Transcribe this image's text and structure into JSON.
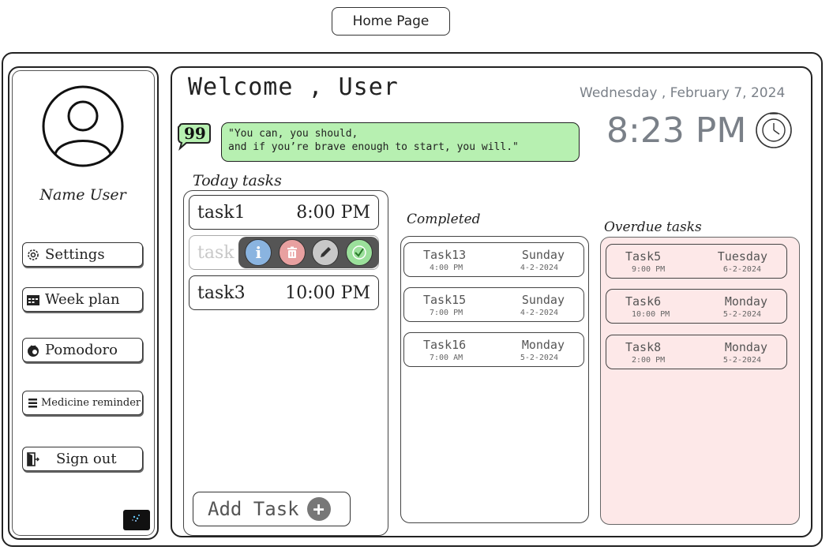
{
  "header": {
    "page_label": "Home Page"
  },
  "sidebar": {
    "user_name": "Name User",
    "items": [
      {
        "label": "Settings",
        "icon": "gear-icon"
      },
      {
        "label": "Week plan",
        "icon": "calendar-icon"
      },
      {
        "label": "Pomodoro",
        "icon": "tomato-timer-icon"
      },
      {
        "label": "Medicine reminder",
        "icon": "medicine-list-icon"
      },
      {
        "label": "Sign out",
        "icon": "exit-door-icon"
      }
    ]
  },
  "main": {
    "welcome": "Welcome , User",
    "date": "Wednesday , February 7, 2024",
    "time": "8:23 PM",
    "quote_line1": "\"You can, you should,",
    "quote_line2": "and if you’re brave enough to start, you will.\"",
    "today_title": "Today tasks",
    "today_tasks": [
      {
        "name": "task1",
        "time": "8:00 PM"
      },
      {
        "name": "task",
        "time": ""
      },
      {
        "name": "task3",
        "time": "10:00 PM"
      }
    ],
    "add_task_label": "Add Task",
    "completed_title": "Completed",
    "completed": [
      {
        "name": "Task13",
        "day": "Sunday",
        "time": "4:00 PM",
        "date": "4-2-2024"
      },
      {
        "name": "Task15",
        "day": "Sunday",
        "time": "7:00 PM",
        "date": "4-2-2024"
      },
      {
        "name": "Task16",
        "day": "Monday",
        "time": "7:00 AM",
        "date": "5-2-2024"
      }
    ],
    "overdue_title": "Overdue tasks",
    "overdue": [
      {
        "name": "Task5",
        "day": "Tuesday",
        "time": "9:00 PM",
        "date": "6-2-2024"
      },
      {
        "name": "Task6",
        "day": "Monday",
        "time": "10:00 PM",
        "date": "5-2-2024"
      },
      {
        "name": "Task8",
        "day": "Monday",
        "time": "2:00 PM",
        "date": "5-2-2024"
      }
    ]
  },
  "colors": {
    "quote_bg": "#b7f0b1",
    "overdue_bg": "#fde8e8",
    "info": "#8ab4e0",
    "delete": "#e8a0a0",
    "edit": "#c8c8c8",
    "done": "#9be09b"
  }
}
